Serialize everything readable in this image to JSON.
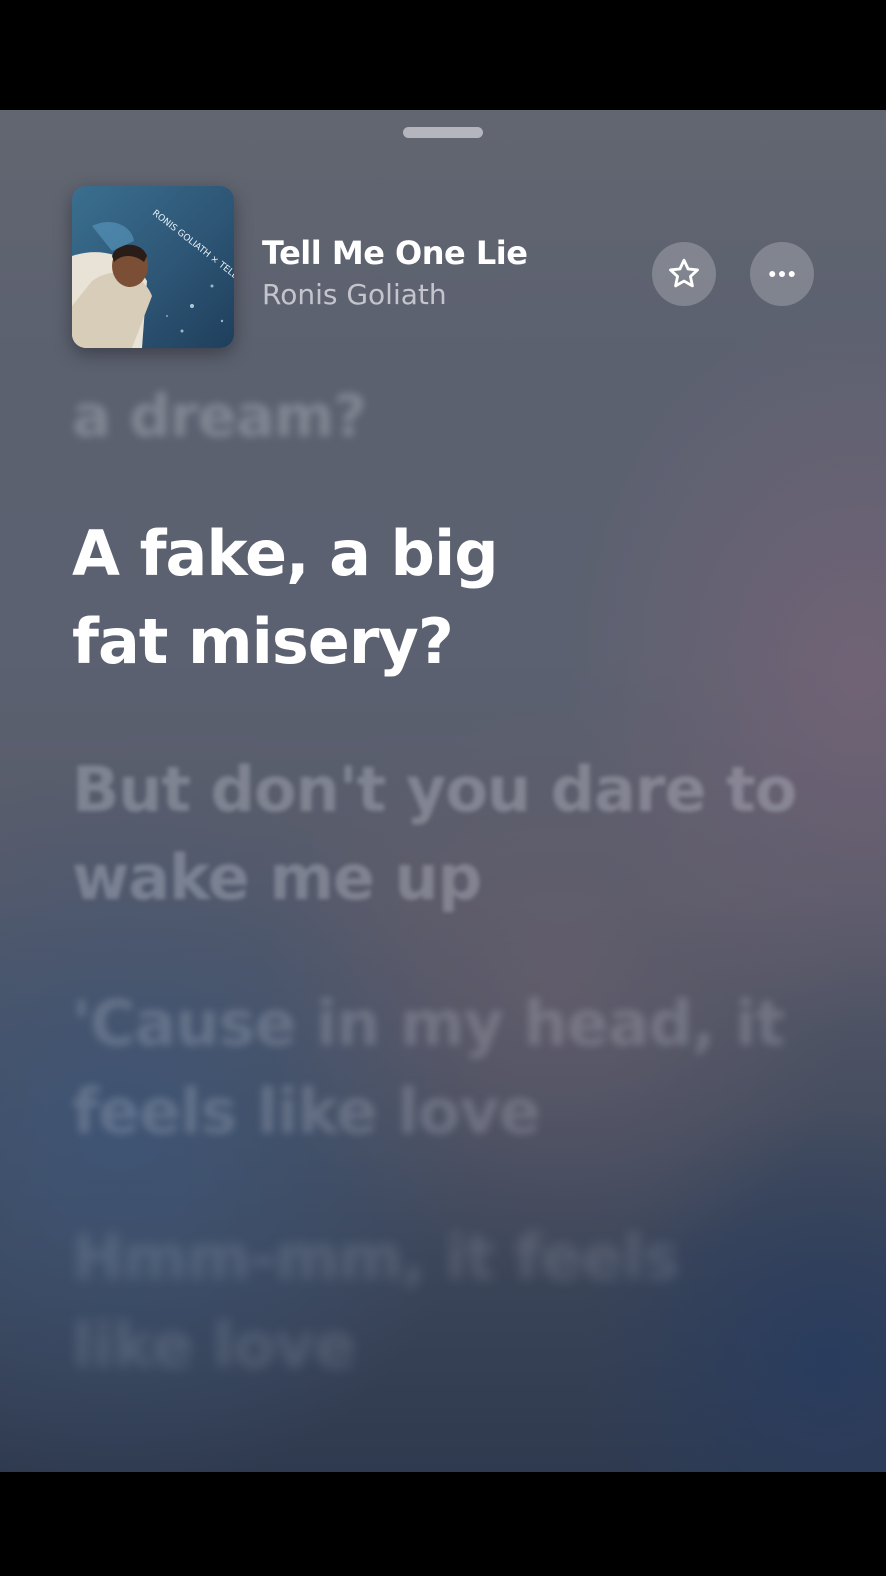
{
  "now_playing": {
    "title": "Tell Me One Lie",
    "artist": "Ronis Goliath",
    "artwork_text": "RONIS GOLIATH × TELL ME ONE LIE"
  },
  "controls": {
    "favorite_icon": "star-icon",
    "more_icon": "ellipsis-icon"
  },
  "lyrics": {
    "previous": "a dream?",
    "current": "A fake, a big\nfat misery?",
    "upcoming": [
      "But don't you dare to\nwake me up",
      "'Cause in my head, it\nfeels like love",
      "Hmm-mm, it feels\nlike love"
    ]
  }
}
